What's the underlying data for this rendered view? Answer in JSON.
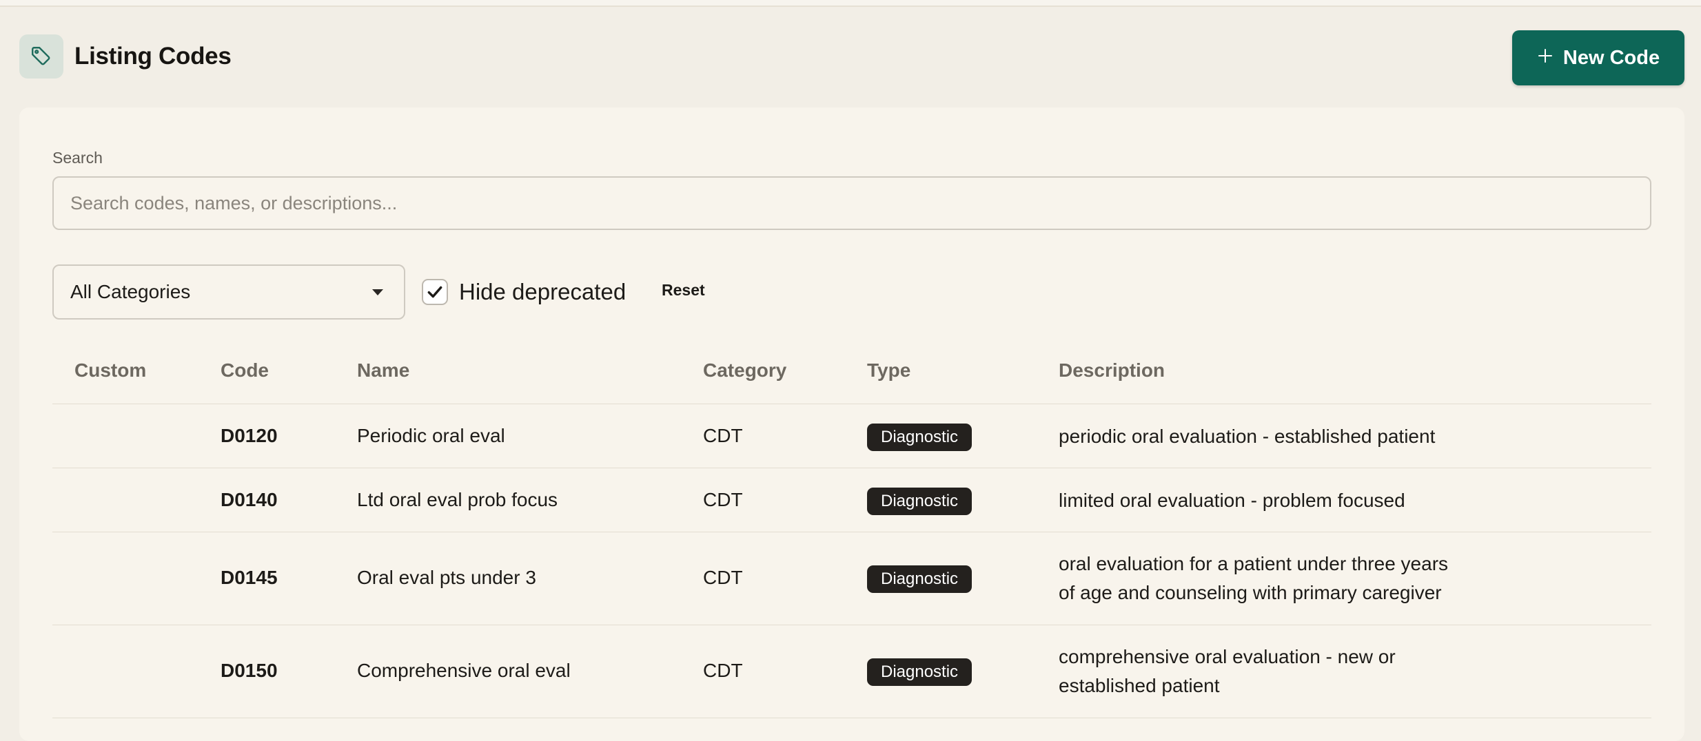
{
  "header": {
    "title": "Listing Codes",
    "title_icon": "tag-icon",
    "new_button_label": "New Code",
    "new_button_icon": "plus-icon"
  },
  "filters": {
    "search_label": "Search",
    "search_placeholder": "Search codes, names, or descriptions...",
    "search_value": "",
    "category_selected": "All Categories",
    "hide_deprecated_label": "Hide deprecated",
    "hide_deprecated_checked": true,
    "reset_label": "Reset"
  },
  "table": {
    "columns": [
      "Custom",
      "Code",
      "Name",
      "Category",
      "Type",
      "Description"
    ],
    "rows": [
      {
        "custom": "",
        "code": "D0120",
        "name": "Periodic oral eval",
        "category": "CDT",
        "type": "Diagnostic",
        "description_lines": [
          "periodic oral evaluation - established patient"
        ]
      },
      {
        "custom": "",
        "code": "D0140",
        "name": "Ltd oral eval prob focus",
        "category": "CDT",
        "type": "Diagnostic",
        "description_lines": [
          "limited oral evaluation - problem focused"
        ]
      },
      {
        "custom": "",
        "code": "D0145",
        "name": "Oral eval pts under 3",
        "category": "CDT",
        "type": "Diagnostic",
        "description_lines": [
          "oral evaluation for a patient under three years",
          "of age and counseling with primary caregiver"
        ]
      },
      {
        "custom": "",
        "code": "D0150",
        "name": "Comprehensive oral eval",
        "category": "CDT",
        "type": "Diagnostic",
        "description_lines": [
          "comprehensive oral evaluation - new or",
          "established patient"
        ]
      }
    ]
  },
  "colors": {
    "accent": "#0d6657",
    "page_bg": "#f2eee6",
    "card_bg": "#f8f4ec",
    "badge_bg": "#24211e"
  }
}
